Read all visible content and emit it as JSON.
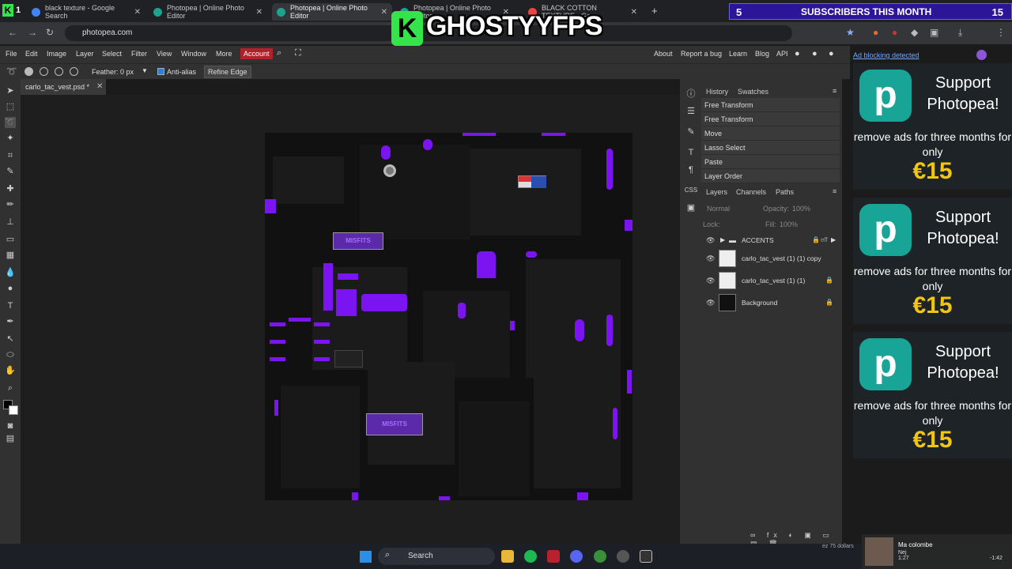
{
  "browser": {
    "tabs": [
      {
        "label": "black texture - Google Search",
        "active": false
      },
      {
        "label": "Photopea | Online Photo Editor",
        "active": false
      },
      {
        "label": "Photopea | Online Photo Editor",
        "active": true
      },
      {
        "label": "Photopea | Online Photo Editor",
        "active": false
      },
      {
        "label": "BLACK COTTON TEXTURE - Go...",
        "active": false
      }
    ],
    "url": "photopea.com",
    "new_tab": "+"
  },
  "menu": {
    "items": [
      "File",
      "Edit",
      "Image",
      "Layer",
      "Select",
      "Filter",
      "View",
      "Window",
      "More"
    ],
    "account": "Account",
    "right_links": [
      "About",
      "Report a bug",
      "Learn",
      "Blog",
      "API"
    ]
  },
  "tool_options": {
    "feather_label": "Feather:",
    "feather_value": "0 px",
    "antialias_label": "Anti-alias",
    "refine_edge": "Refine Edge"
  },
  "document": {
    "tab_label": "carlo_tac_vest.psd *",
    "canvas_tags": [
      "MISFITS",
      "MISFITS"
    ]
  },
  "history": {
    "tabs": [
      "History",
      "Swatches"
    ],
    "items": [
      "Free Transform",
      "Free Transform",
      "Move",
      "Lasso Select",
      "Paste",
      "Layer Order"
    ]
  },
  "layers": {
    "tabs": [
      "Layers",
      "Channels",
      "Paths"
    ],
    "blend_mode": "Normal",
    "opacity_label": "Opacity:",
    "opacity_value": "100%",
    "lock_label": "Lock:",
    "fill_label": "Fill:",
    "fill_value": "100%",
    "items": [
      {
        "name": "ACCENTS",
        "type": "folder",
        "extra": "eff"
      },
      {
        "name": "carlo_tac_vest (1) (1) copy",
        "type": "layer"
      },
      {
        "name": "carlo_tac_vest (1) (1)",
        "type": "layer"
      },
      {
        "name": "Background",
        "type": "background"
      }
    ]
  },
  "ads": {
    "label": "Ad blocking detected",
    "cards": [
      {
        "headline": "Support Photopea!",
        "body": "remove ads for three months for only",
        "price": "€15"
      },
      {
        "headline": "Support Photopea!",
        "body": "remove ads for three months for only",
        "price": "€15"
      },
      {
        "headline": "Support Photopea!",
        "body": "remove ads for three months for only",
        "price": "€15"
      }
    ]
  },
  "overlay": {
    "sub_count": "5",
    "sub_text": "SUBSCRIBERS THIS MONTH",
    "sub_goal": "15",
    "brand": "GHOSTYYFPS",
    "brand_letter": "K",
    "top_left_counter": "1",
    "chat_line": "ez 75 dollars",
    "now_playing_title": "Ma colombe",
    "now_playing_artist": "Nej",
    "now_playing_time": "1:27",
    "now_playing_remaining": "-1:42"
  },
  "taskbar": {
    "search_label": "Search"
  },
  "colors": {
    "accent_purple": "#7a14f0",
    "account_red": "#b0222a",
    "photopea_teal": "#18a497",
    "price_yellow": "#f2c512"
  }
}
